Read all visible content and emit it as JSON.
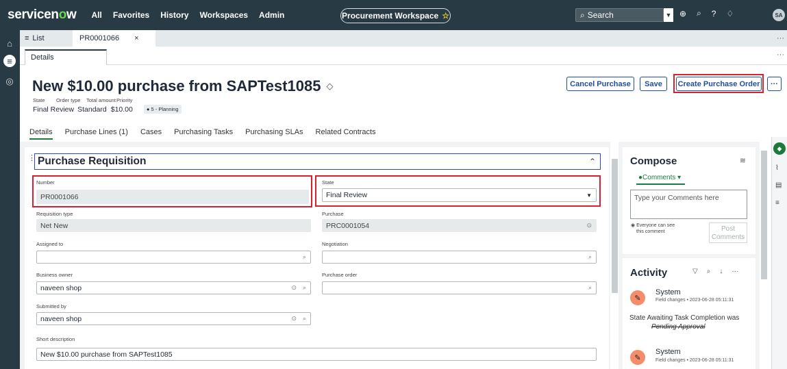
{
  "topnav": {
    "brand": "servicenow",
    "links": [
      "All",
      "Favorites",
      "History",
      "Workspaces",
      "Admin"
    ],
    "workspace": "Procurement Workspace",
    "search_placeholder": "Search",
    "avatar": "SA"
  },
  "tabs": {
    "list_label": "List",
    "record_label": "PR0001066",
    "subtab_label": "Details"
  },
  "record": {
    "title": "New $10.00 purchase from SAPTest1085",
    "header_labels": [
      "State",
      "Order type",
      "Total amount",
      "Priority"
    ],
    "state": "Final Review",
    "order_type": "Standard",
    "total_amount": "$10.00",
    "priority": "5 - Planning"
  },
  "actions": {
    "cancel": "Cancel Purchase",
    "save": "Save",
    "create_po": "Create Purchase Order",
    "more": "···"
  },
  "section_tabs": [
    "Details",
    "Purchase Lines (1)",
    "Cases",
    "Purchasing Tasks",
    "Purchasing SLAs",
    "Related Contracts"
  ],
  "form": {
    "section_title": "Purchase Requisition",
    "number_label": "Number",
    "number_value": "PR0001066",
    "state_label": "State",
    "state_value": "Final Review",
    "req_type_label": "Requisition type",
    "req_type_value": "Net New",
    "purchase_label": "Purchase",
    "purchase_value": "PRC0001054",
    "assigned_label": "Assigned to",
    "assigned_value": "",
    "negotiation_label": "Negotiation",
    "negotiation_value": "",
    "owner_label": "Business owner",
    "owner_value": "naveen shop",
    "po_label": "Purchase order",
    "po_value": "",
    "submitted_label": "Submitted by",
    "submitted_value": "naveen shop",
    "short_desc_label": "Short description",
    "short_desc_value": "New $10.00 purchase from SAPTest1085"
  },
  "compose": {
    "title": "Compose",
    "tab": "Comments",
    "placeholder": "Type your Comments here",
    "visibility_line1": "Everyone can see",
    "visibility_line2": "this comment",
    "post_line1": "Post",
    "post_line2": "Comments"
  },
  "activity": {
    "title": "Activity",
    "entries": [
      {
        "author": "System",
        "meta": "Field changes • 2023-06-28 05:11:31",
        "field": "State",
        "new_value": "Awaiting Task Completion was",
        "old_value": "Pending Approval"
      },
      {
        "author": "System",
        "meta": "Field changes • 2023-06-28 05:11:31"
      }
    ]
  },
  "colors": {
    "nav": "#283a43",
    "accent_blue": "#1f4f9b",
    "highlight_red": "#dc1f2e",
    "brand_green": "#62d84e",
    "activity_orange": "#f58c6b"
  }
}
